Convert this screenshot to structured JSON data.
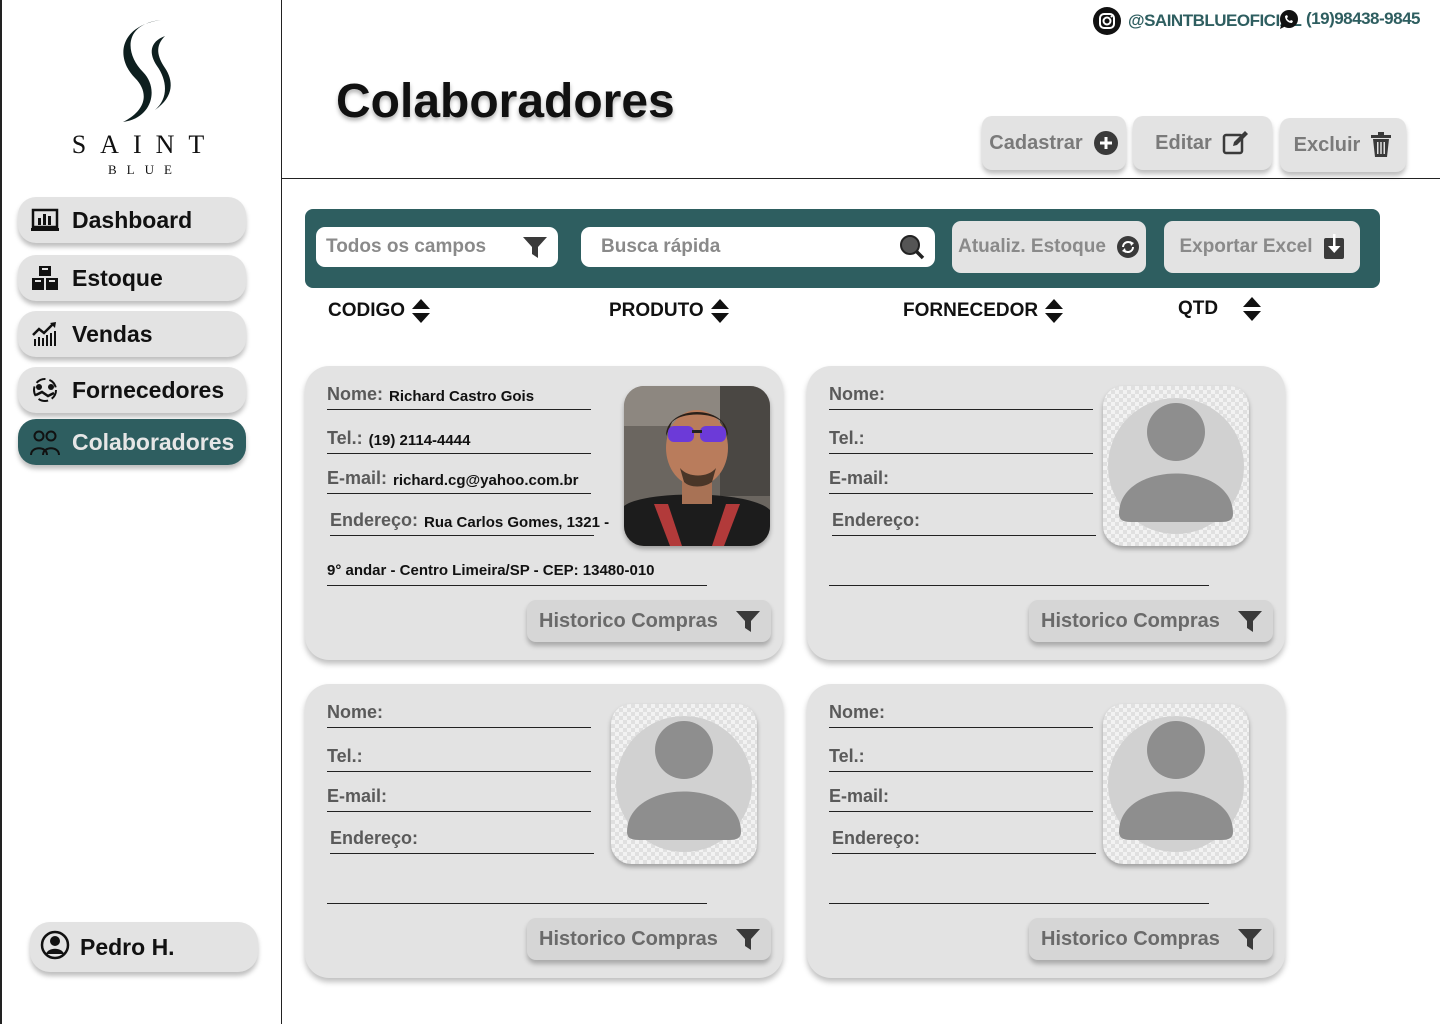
{
  "brand": {
    "name": "SAINT",
    "sub": "BLUE",
    "accent": "#2e5e60"
  },
  "contacts": {
    "instagram": "@SAINTBLUEOFICIAL",
    "whatsapp": "(19)98438-9845"
  },
  "sidebar": {
    "items": [
      {
        "label": "Dashboard",
        "icon": "bar-chart-icon"
      },
      {
        "label": "Estoque",
        "icon": "boxes-icon"
      },
      {
        "label": "Vendas",
        "icon": "sales-chart-icon"
      },
      {
        "label": "Fornecedores",
        "icon": "handshake-icon"
      },
      {
        "label": "Colaboradores",
        "icon": "team-icon",
        "active": true
      }
    ],
    "user": "Pedro H."
  },
  "header": {
    "title": "Colaboradores",
    "actions": {
      "add": "Cadastrar",
      "edit": "Editar",
      "delete": "Excluir"
    }
  },
  "toolbar": {
    "filter_placeholder": "Todos os campos",
    "search_placeholder": "Busca rápida",
    "update_stock": "Atualiz. Estoque",
    "export_excel": "Exportar Excel"
  },
  "columns": [
    "CODIGO",
    "PRODUTO",
    "FORNECEDOR",
    "QTD"
  ],
  "labels": {
    "name": "Nome:",
    "phone": "Tel.:",
    "email": "E-mail:",
    "address": "Endereço:",
    "history": "Historico Compras"
  },
  "cards": [
    {
      "name": "Richard Castro Gois",
      "phone": "(19) 2114-4444",
      "email": "richard.cg@yahoo.com.br",
      "address": "Rua Carlos Gomes, 1321 -",
      "address2": "9° andar - Centro Limeira/SP - CEP: 13480-010"
    },
    {
      "name": "",
      "phone": "",
      "email": "",
      "address": "",
      "address2": ""
    },
    {
      "name": "",
      "phone": "",
      "email": "",
      "address": "",
      "address2": ""
    },
    {
      "name": "",
      "phone": "",
      "email": "",
      "address": "",
      "address2": ""
    }
  ]
}
